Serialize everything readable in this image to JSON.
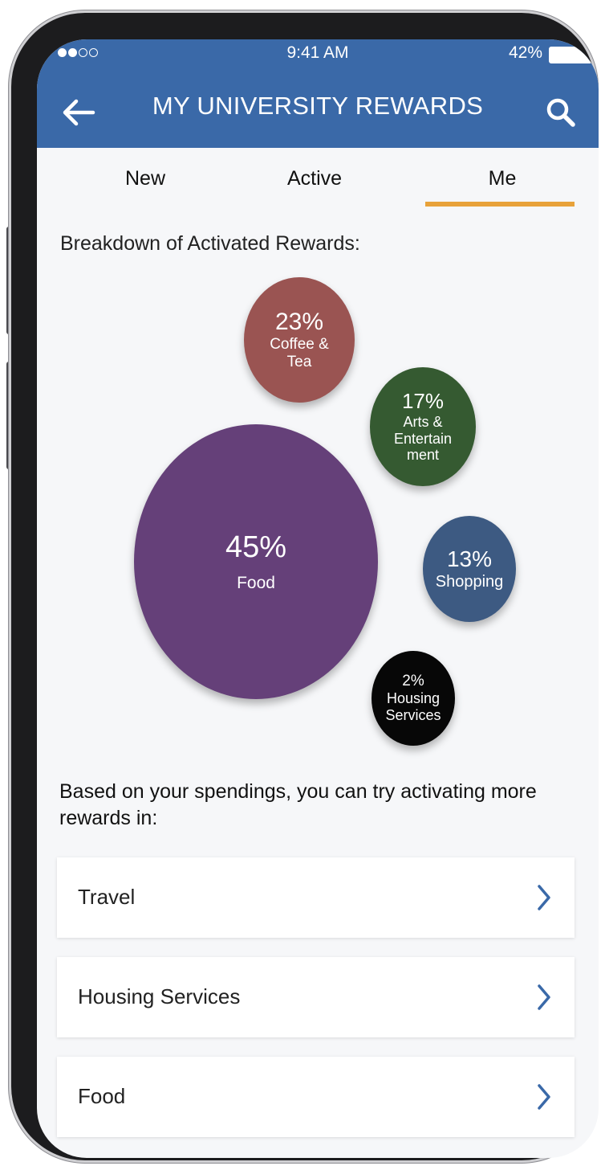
{
  "status_bar": {
    "time": "9:41 AM",
    "battery": "42%",
    "signal_dots": 4,
    "signal_filled": 2
  },
  "header": {
    "title": "MY UNIVERSITY REWARDS",
    "back_icon": "arrow-left-icon",
    "search_icon": "search-icon",
    "color": "#3a69a8"
  },
  "tabs": {
    "items": [
      {
        "label": "New"
      },
      {
        "label": "Active"
      },
      {
        "label": "Me"
      }
    ],
    "selected": "Me",
    "underline_color": "#e8a23a"
  },
  "breakdown": {
    "title": "Breakdown of Activated Rewards:",
    "chart_data": {
      "type": "bubble",
      "series": [
        {
          "percent": "23%",
          "label": "Coffee & Tea",
          "value": 23,
          "color": "#9a5452"
        },
        {
          "percent": "17%",
          "label": "Arts & Entertain ment",
          "value": 17,
          "color": "#355a31"
        },
        {
          "percent": "45%",
          "label": "Food",
          "value": 45,
          "color": "#654079"
        },
        {
          "percent": "13%",
          "label": "Shopping",
          "value": 13,
          "color": "#3d5a82"
        },
        {
          "percent": "2%",
          "label": "Housing Services",
          "value": 2,
          "color": "#070707"
        }
      ]
    }
  },
  "suggestions": {
    "intro": "Based on your spendings, you can try activating more rewards in:",
    "items": [
      {
        "label": "Travel",
        "icon": "chevron-right-icon"
      },
      {
        "label": "Housing Services",
        "icon": "chevron-right-icon"
      },
      {
        "label": "Food",
        "icon": "chevron-right-icon"
      }
    ]
  }
}
